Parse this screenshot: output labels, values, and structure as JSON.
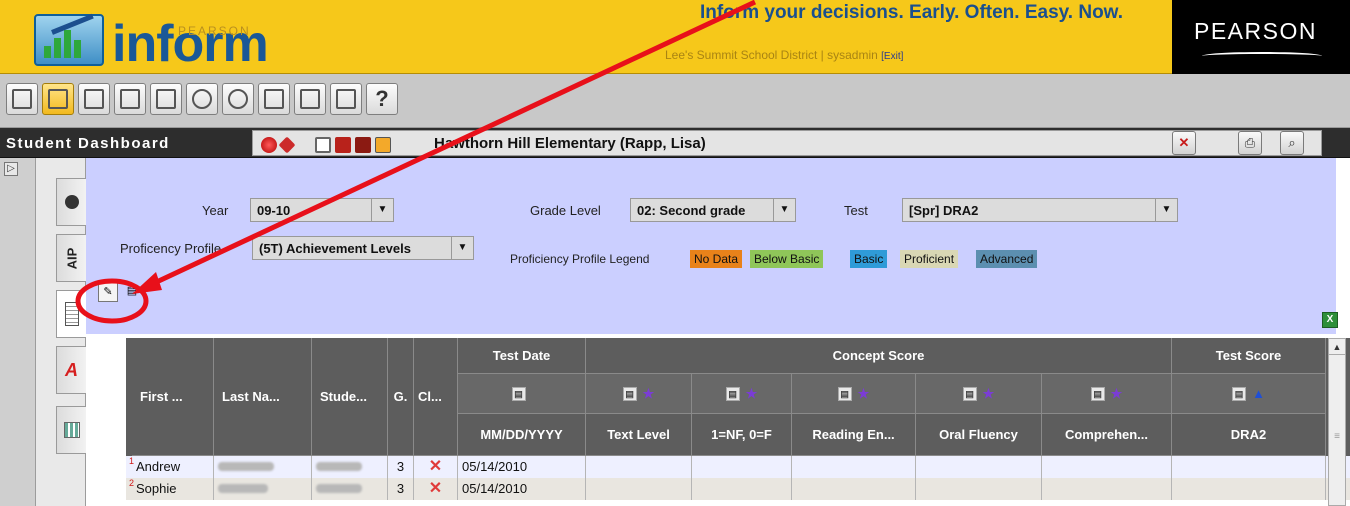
{
  "header": {
    "logo_small": "PEARSON",
    "logo_word": "inform",
    "tagline": "Inform your decisions. Early. Often. Easy. Now.",
    "district": "Lee's Summit School District | sysadmin",
    "exit_label": "[Exit]",
    "brand": "PEARSON"
  },
  "toolbar": {
    "buttons": [
      "grid-icon",
      "dashboard-icon",
      "report-icon",
      "test-icon",
      "chart-icon",
      "group-icon",
      "gauge-icon",
      "list-icon",
      "tools-icon",
      "export-icon"
    ],
    "help_label": "?"
  },
  "dashbar": {
    "title": "Student Dashboard",
    "school": "Hawthorn Hill Elementary (Rapp, Lisa)"
  },
  "sidetabs": {
    "aip_label": "AIP",
    "a_label": "A"
  },
  "filters": {
    "year_label": "Year",
    "year_value": "09-10",
    "grade_label": "Grade Level",
    "grade_value": "02: Second grade",
    "test_label": "Test",
    "test_value": "[Spr] DRA2",
    "profile_label": "Proficency Profile",
    "profile_value": "(5T) Achievement Levels",
    "legend_label": "Proficiency Profile Legend",
    "legend": [
      {
        "label": "No Data",
        "color": "#e8821a"
      },
      {
        "label": "Below Basic",
        "color": "#8fc659"
      },
      {
        "label": "Basic",
        "color": "#2f9bd8"
      },
      {
        "label": "Proficient",
        "color": "#d9d7b4"
      },
      {
        "label": "Advanced",
        "color": "#5c8fb0"
      }
    ]
  },
  "table": {
    "groups": {
      "test_date": "Test Date",
      "concept_score": "Concept Score",
      "test_score": "Test Score"
    },
    "columns": {
      "first": "First ...",
      "last": "Last Na...",
      "student": "Stude...",
      "grade": "G.",
      "class": "Cl...",
      "date_fmt": "MM/DD/YYYY",
      "text_level": "Text Level",
      "nf": "1=NF, 0=F",
      "reading": "Reading En...",
      "oral": "Oral Fluency",
      "compre": "Comprehen...",
      "dra2": "DRA2"
    },
    "rows": [
      {
        "num": "1",
        "first": "Andrew",
        "grade": "3",
        "date": "05/14/2010"
      },
      {
        "num": "2",
        "first": "Sophie",
        "grade": "3",
        "date": "05/14/2010"
      }
    ]
  },
  "colors": {
    "header_yellow": "#f6c81a",
    "filter_bg": "#cbcfff",
    "annotation_red": "#e8101a"
  }
}
